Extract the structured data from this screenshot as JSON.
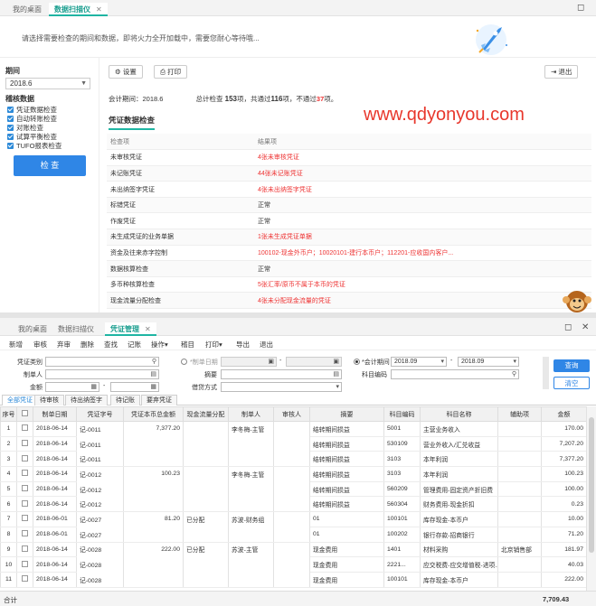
{
  "top": {
    "tabs": [
      {
        "label": "我的桌面"
      },
      {
        "label": "数据扫描仪"
      }
    ],
    "banner": {
      "message": "请选择需要检查的期间和数据，即将火力全开加载中，需要您耐心等待哦..."
    },
    "left": {
      "period_label": "期间",
      "period_value": "2018.6",
      "check_data_label": "稽核数据",
      "options": [
        "凭证数据检查",
        "自动转账检查",
        "对账检查",
        "试算平衡检查",
        "TUFO报表检查"
      ],
      "check_button": "检 查"
    },
    "toolbar": {
      "settings": "设置",
      "print": "打印",
      "exit": "退出"
    },
    "summary": {
      "period_text": "会计期间：2018.6",
      "total_prefix": "总计检查",
      "total": "153",
      "pass_prefix": "项，共通过",
      "pass": "116",
      "fail_prefix": "项，不通过",
      "fail": "37",
      "suffix": "项。"
    },
    "section_title": "凭证数据检查",
    "check_table": {
      "headers": [
        "检查项",
        "结果项"
      ],
      "rows": [
        {
          "item": "未审核凭证",
          "result": "4张未审核凭证",
          "status": "error"
        },
        {
          "item": "未记账凭证",
          "result": "44张未记账凭证",
          "status": "error"
        },
        {
          "item": "未出纳签字凭证",
          "result": "4张未出纳签字凭证",
          "status": "error"
        },
        {
          "item": "标错凭证",
          "result": "正常",
          "status": "ok"
        },
        {
          "item": "作废凭证",
          "result": "正常",
          "status": "ok"
        },
        {
          "item": "未生成凭证的业务单据",
          "result": "1张未生成凭证单据",
          "status": "error"
        },
        {
          "item": "资金及往来赤字控制",
          "result": "100102-现金外币户；10020101-建行本币户；112201-应收国内客户...",
          "status": "error"
        },
        {
          "item": "数据核算检查",
          "result": "正常",
          "status": "ok"
        },
        {
          "item": "多币种核算检查",
          "result": "5张汇率/原币不属于本币的凭证",
          "status": "error"
        },
        {
          "item": "现金流量分配检查",
          "result": "4张未分配现金流量的凭证",
          "status": "error"
        }
      ]
    },
    "watermark": "www.qdyonyou.com"
  },
  "bottom": {
    "tabs": [
      {
        "label": "我的桌面"
      },
      {
        "label": "数据扫描仪"
      },
      {
        "label": "凭证管理"
      }
    ],
    "toolbar": [
      "新增",
      "审核",
      "弃审",
      "删除",
      "查找",
      "记账",
      "操作",
      "稽目",
      "打印",
      "导出",
      "退出"
    ],
    "filters": {
      "voucher_type": "凭证类别",
      "maker": "制单人",
      "amount": "金额",
      "make_date": "*制单日期",
      "summary": "摘要",
      "amount_direction": "借贷方式",
      "acc_period": "*会计期间",
      "period_from": "2018.09",
      "period_to": "2018.09",
      "subject_code": "科目编码",
      "query_button": "查询",
      "clear_button": "清空"
    },
    "subtabs": [
      "全部凭证",
      "待审核",
      "待出纳签字",
      "待记账",
      "要弃凭证"
    ],
    "columns": [
      "序号",
      "",
      "制单日期",
      "凭证字号",
      "凭证本币总金额",
      "现金流量分配",
      "制单人",
      "审核人",
      "摘要",
      "科目编码",
      "科目名称",
      "辅助项",
      "金额"
    ],
    "rows": [
      {
        "no": "1",
        "date": "2018-06-14",
        "vno": "记-0011",
        "total": "7,377.20",
        "cash": "",
        "maker": "李冬梅-主管",
        "auditor": "",
        "summary": "结转期间损益",
        "code": "5001",
        "subject": "主营业务收入",
        "aux": "",
        "amount": "170.00"
      },
      {
        "no": "2",
        "date": "2018-06-14",
        "vno": "记-0011",
        "total": "",
        "cash": "",
        "maker": "",
        "auditor": "",
        "summary": "结转期间损益",
        "code": "530109",
        "subject": "营业外收入/汇兑收益",
        "aux": "",
        "amount": "7,207.20"
      },
      {
        "no": "3",
        "date": "2018-06-14",
        "vno": "记-0011",
        "total": "",
        "cash": "",
        "maker": "",
        "auditor": "",
        "summary": "结转期间损益",
        "code": "3103",
        "subject": "本年利润",
        "aux": "",
        "amount": "7,377.20"
      },
      {
        "no": "4",
        "date": "2018-06-14",
        "vno": "记-0012",
        "total": "100.23",
        "cash": "",
        "maker": "李冬梅-主管",
        "auditor": "",
        "summary": "结转期间损益",
        "code": "3103",
        "subject": "本年利润",
        "aux": "",
        "amount": "100.23"
      },
      {
        "no": "5",
        "date": "2018-06-14",
        "vno": "记-0012",
        "total": "",
        "cash": "",
        "maker": "",
        "auditor": "",
        "summary": "结转期间损益",
        "code": "560209",
        "subject": "管理费用-固定资产折旧费",
        "aux": "",
        "amount": "100.00"
      },
      {
        "no": "6",
        "date": "2018-06-14",
        "vno": "记-0012",
        "total": "",
        "cash": "",
        "maker": "",
        "auditor": "",
        "summary": "结转期间损益",
        "code": "560304",
        "subject": "财务费用-现金折扣",
        "aux": "",
        "amount": "0.23"
      },
      {
        "no": "7",
        "date": "2018-06-01",
        "vno": "记-0027",
        "total": "81.20",
        "cash": "已分配",
        "maker": "苏波-财务组",
        "auditor": "",
        "summary": "01",
        "code": "100101",
        "subject": "库存现金-本币户",
        "aux": "",
        "amount": "10.00"
      },
      {
        "no": "8",
        "date": "2018-06-01",
        "vno": "记-0027",
        "total": "",
        "cash": "",
        "maker": "",
        "auditor": "",
        "summary": "01",
        "code": "100202",
        "subject": "银行存款-招商银行",
        "aux": "",
        "amount": "71.20"
      },
      {
        "no": "9",
        "date": "2018-06-14",
        "vno": "记-0028",
        "total": "222.00",
        "cash": "已分配",
        "maker": "苏波-主管",
        "auditor": "",
        "summary": "现金费用",
        "code": "1401",
        "subject": "材料采购",
        "aux": "北京销售部",
        "amount": "181.97"
      },
      {
        "no": "10",
        "date": "2018-06-14",
        "vno": "记-0028",
        "total": "",
        "cash": "",
        "maker": "",
        "auditor": "",
        "summary": "现金费用",
        "code": "2221...",
        "subject": "应交税费-应交增值税-进项...",
        "aux": "",
        "amount": "40.03"
      },
      {
        "no": "11",
        "date": "2018-06-14",
        "vno": "记-0028",
        "total": "",
        "cash": "",
        "maker": "",
        "auditor": "",
        "summary": "现金费用",
        "code": "100101",
        "subject": "库存现金-本币户",
        "aux": "",
        "amount": "222.00"
      }
    ],
    "total_label": "合计",
    "total_value": "7,709.43"
  }
}
